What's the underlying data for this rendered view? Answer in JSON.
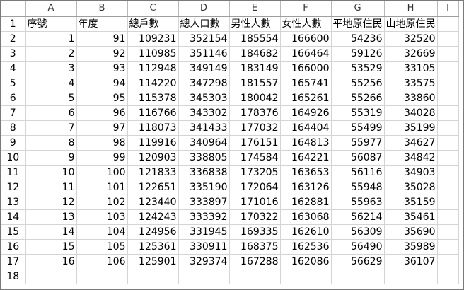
{
  "columns": [
    "A",
    "B",
    "C",
    "D",
    "E",
    "F",
    "G",
    "H",
    "I"
  ],
  "header": [
    "序號",
    "年度",
    "總戶數",
    "總人口數",
    "男性人數",
    "女性人數",
    "平地原住民",
    "山地原住民"
  ],
  "rows": [
    [
      "1",
      "91",
      "109231",
      "352154",
      "185554",
      "166600",
      "54236",
      "32520"
    ],
    [
      "2",
      "92",
      "110985",
      "351146",
      "184682",
      "166464",
      "59126",
      "32669"
    ],
    [
      "3",
      "93",
      "112948",
      "349149",
      "183149",
      "166000",
      "53529",
      "33105"
    ],
    [
      "4",
      "94",
      "114220",
      "347298",
      "181557",
      "165741",
      "55256",
      "33575"
    ],
    [
      "5",
      "95",
      "115378",
      "345303",
      "180042",
      "165261",
      "55266",
      "33860"
    ],
    [
      "6",
      "96",
      "116766",
      "343302",
      "178376",
      "164926",
      "55319",
      "34028"
    ],
    [
      "7",
      "97",
      "118073",
      "341433",
      "177032",
      "164404",
      "55499",
      "35199"
    ],
    [
      "8",
      "98",
      "119916",
      "340964",
      "176151",
      "164813",
      "55977",
      "34627"
    ],
    [
      "9",
      "99",
      "120903",
      "338805",
      "174584",
      "164221",
      "56087",
      "34842"
    ],
    [
      "10",
      "100",
      "121833",
      "336838",
      "173205",
      "163653",
      "56116",
      "34903"
    ],
    [
      "11",
      "101",
      "122651",
      "335190",
      "172064",
      "163126",
      "55948",
      "35028"
    ],
    [
      "12",
      "102",
      "123440",
      "333897",
      "171016",
      "162881",
      "55963",
      "35159"
    ],
    [
      "13",
      "103",
      "124243",
      "333392",
      "170322",
      "163068",
      "56214",
      "35461"
    ],
    [
      "14",
      "104",
      "124956",
      "331945",
      "169335",
      "162610",
      "56309",
      "35690"
    ],
    [
      "15",
      "105",
      "125361",
      "330911",
      "168375",
      "162536",
      "56490",
      "35989"
    ],
    [
      "16",
      "106",
      "125901",
      "329374",
      "167288",
      "162086",
      "56629",
      "36107"
    ]
  ],
  "row_numbers": [
    "1",
    "2",
    "3",
    "4",
    "5",
    "6",
    "7",
    "8",
    "9",
    "10",
    "11",
    "12",
    "13",
    "14",
    "15",
    "16",
    "17",
    "18"
  ]
}
